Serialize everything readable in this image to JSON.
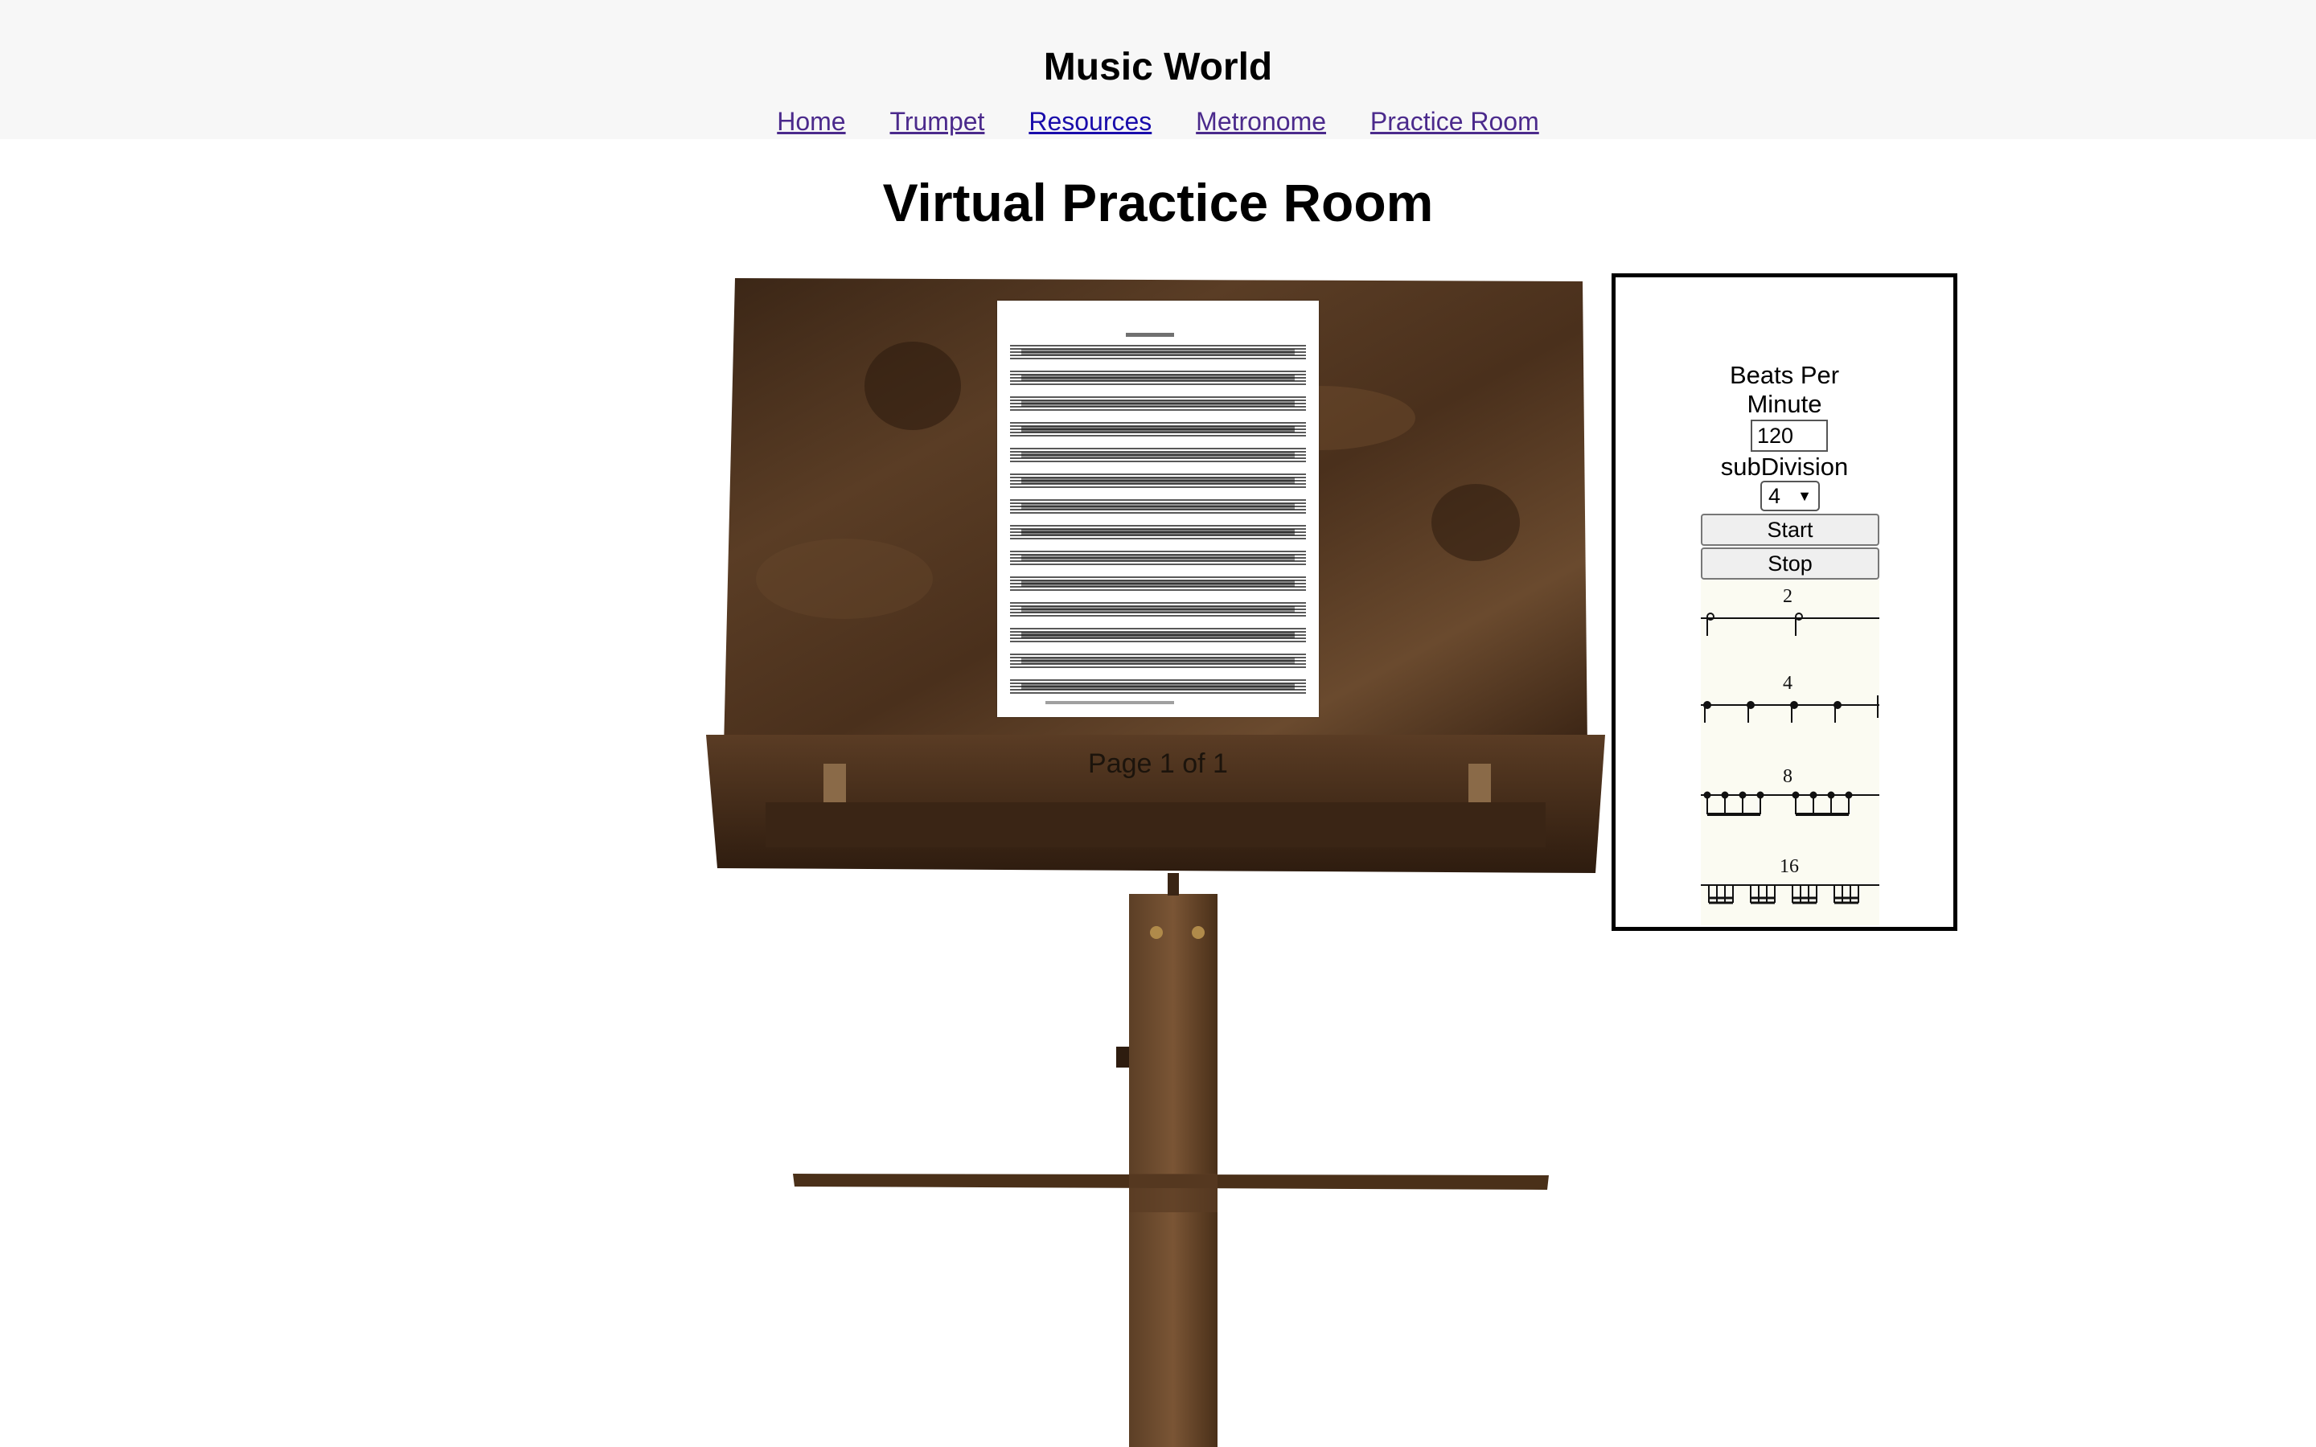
{
  "header": {
    "site_title": "Music World",
    "nav": [
      {
        "label": "Home"
      },
      {
        "label": "Trumpet"
      },
      {
        "label": "Resources"
      },
      {
        "label": "Metronome"
      },
      {
        "label": "Practice Room"
      }
    ]
  },
  "main": {
    "title": "Virtual Practice Room",
    "sheet_music": {
      "page_indicator": "Page 1 of 1"
    }
  },
  "metronome": {
    "bpm_label_line1": "Beats Per",
    "bpm_label_line2": "Minute",
    "bpm_value": "120",
    "subdivision_label": "subDivision",
    "subdivision_selected": "4",
    "start_label": "Start",
    "stop_label": "Stop",
    "rhythm_labels": [
      "2",
      "4",
      "8",
      "16"
    ]
  },
  "colors": {
    "header_bg": "#f7f7f7",
    "wood": "#4a3220",
    "link": "#4b2a8c"
  }
}
